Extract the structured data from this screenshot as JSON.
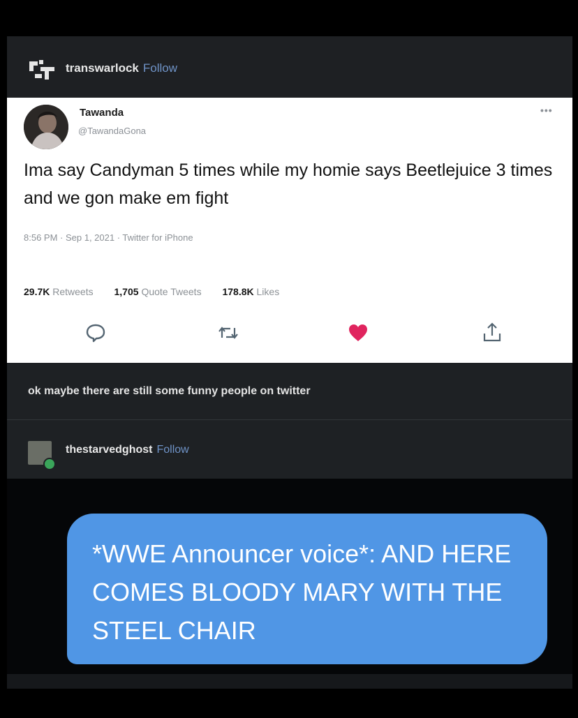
{
  "post1": {
    "username": "transwarlock",
    "follow_label": "Follow"
  },
  "tweet": {
    "display_name": "Tawanda",
    "handle": "@TawandaGona",
    "more_label": "•••",
    "text": "Ima say Candyman 5 times while my homie says Beetlejuice 3 times and we gon make em fight",
    "meta": "8:56 PM · Sep 1, 2021 · Twitter for iPhone",
    "stats": {
      "retweets_count": "29.7K",
      "retweets_label": "Retweets",
      "quotes_count": "1,705",
      "quotes_label": "Quote Tweets",
      "likes_count": "178.8K",
      "likes_label": "Likes"
    },
    "actions": [
      "reply-icon",
      "retweet-icon",
      "like-icon",
      "share-icon"
    ],
    "like_color": "#e0245e"
  },
  "caption": "ok maybe there are still some funny people on twitter",
  "post2": {
    "username": "thestarvedghost",
    "follow_label": "Follow"
  },
  "message": {
    "text": "*WWE Announcer voice*: AND HERE COMES BLOODY MARY WITH THE STEEL CHAIR",
    "bubble_color": "#5096e5"
  },
  "colors": {
    "background": "#000000",
    "panel": "#1e2124",
    "link": "#6f93c7"
  }
}
